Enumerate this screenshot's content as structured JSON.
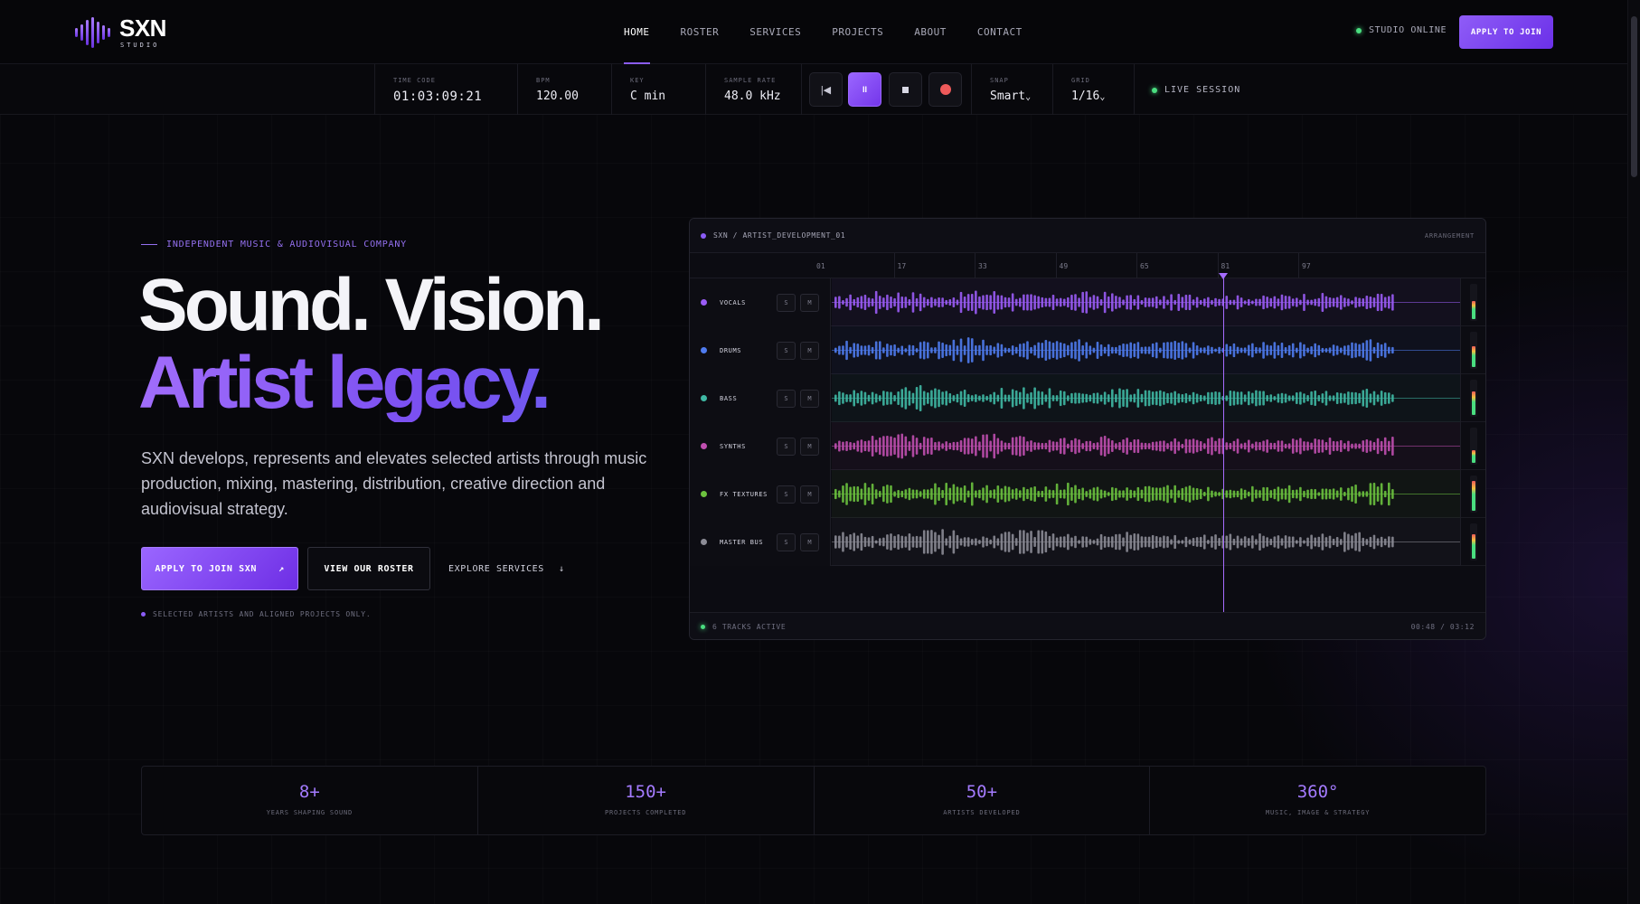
{
  "brand": {
    "name": "SXN",
    "sub": "STUDIO"
  },
  "nav": {
    "items": [
      {
        "label": "HOME",
        "active": true
      },
      {
        "label": "ROSTER",
        "active": false
      },
      {
        "label": "SERVICES",
        "active": false
      },
      {
        "label": "PROJECTS",
        "active": false
      },
      {
        "label": "ABOUT",
        "active": false
      },
      {
        "label": "CONTACT",
        "active": false
      }
    ],
    "status": "STUDIO ONLINE",
    "cta": "APPLY TO JOIN"
  },
  "transport": {
    "timecode": {
      "label": "TIME CODE",
      "value": "01:03:09:21"
    },
    "bpm": {
      "label": "BPM",
      "value": "120.00"
    },
    "key": {
      "label": "KEY",
      "value": "C min"
    },
    "sample_rate": {
      "label": "SAMPLE RATE",
      "value": "48.0 kHz"
    },
    "buttons": {
      "rewind": "|◀",
      "pause": "II"
    },
    "snap": {
      "label": "SNAP",
      "value": "Smart",
      "caret": "⌄"
    },
    "grid": {
      "label": "GRID",
      "value": "1/16",
      "caret": "⌄"
    },
    "live": "LIVE SESSION"
  },
  "hero": {
    "eyebrow": "INDEPENDENT MUSIC & AUDIOVISUAL COMPANY",
    "headline_line1": "Sound. Vision.",
    "headline_line2": "Artist legacy.",
    "description": "SXN develops, represents and elevates selected artists through music production, mixing, mastering, distribution, creative direction and audiovisual strategy.",
    "cta_primary": "APPLY TO JOIN SXN",
    "cta_primary_icon": "↗",
    "cta_secondary": "VIEW OUR ROSTER",
    "cta_link": "EXPLORE SERVICES",
    "cta_link_icon": "↓",
    "note": "SELECTED ARTISTS AND ALIGNED PROJECTS ONLY."
  },
  "daw": {
    "breadcrumb": "SXN / ARTIST_DEVELOPMENT_01",
    "mode": "ARRANGEMENT",
    "ruler": [
      "01",
      "17",
      "33",
      "49",
      "65",
      "81",
      "97"
    ],
    "solo_label": "S",
    "mute_label": "M",
    "playhead_bar": 81,
    "tracks": [
      {
        "name": "VOCALS",
        "color": "#9b5cf6",
        "level": 0.55
      },
      {
        "name": "DRUMS",
        "color": "#4f7cf0",
        "level": 0.62
      },
      {
        "name": "BASS",
        "color": "#3fb8a4",
        "level": 0.7
      },
      {
        "name": "SYNTHS",
        "color": "#c04fb0",
        "level": 0.38
      },
      {
        "name": "FX TEXTURES",
        "color": "#6cc23e",
        "level": 0.9
      },
      {
        "name": "MASTER BUS",
        "color": "#8c8c96",
        "level": 0.72
      }
    ],
    "footer_status": "6 TRACKS ACTIVE",
    "footer_time": "00:48 / 03:12"
  },
  "stats": [
    {
      "value": "8+",
      "label": "YEARS SHAPING SOUND"
    },
    {
      "value": "150+",
      "label": "PROJECTS COMPLETED"
    },
    {
      "value": "50+",
      "label": "ARTISTS DEVELOPED"
    },
    {
      "value": "360°",
      "label": "MUSIC, IMAGE & STRATEGY"
    }
  ]
}
